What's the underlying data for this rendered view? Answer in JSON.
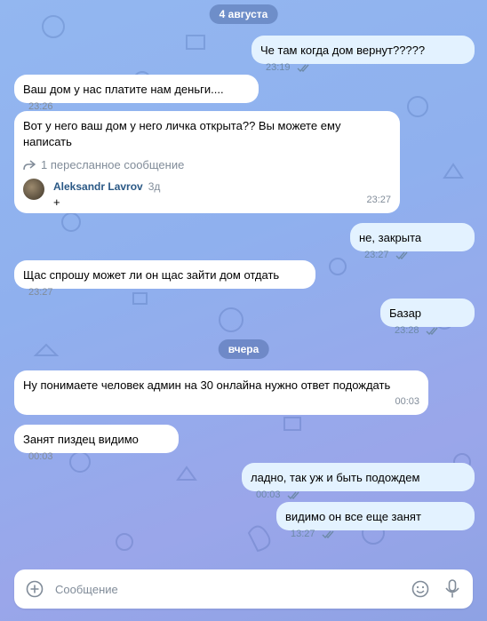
{
  "dates": [
    "4 августа",
    "вчера"
  ],
  "messages": [
    {
      "text": "Че там когда дом вернут?????",
      "time": "23:19",
      "dir": "out"
    },
    {
      "text": "Ваш дом у нас платите нам деньги....",
      "time": "23:26",
      "dir": "in"
    },
    {
      "text": "Вот у него ваш дом у него личка открыта?? Вы можете ему написать",
      "time": "23:27",
      "dir": "in",
      "forwarded": {
        "header": "1 пересланное сообщение",
        "author": "Aleksandr Lavrov",
        "ago": "3д",
        "text": "+"
      }
    },
    {
      "text": "не, закрыта",
      "time": "23:27",
      "dir": "out"
    },
    {
      "text": "Щас спрошу может ли он щас зайти дом отдать",
      "time": "23:27",
      "dir": "in"
    },
    {
      "text": "Базар",
      "time": "23:28",
      "dir": "out"
    },
    {
      "text": "Ну понимаете человек админ на 30 онлайна нужно ответ подождать",
      "time": "00:03",
      "dir": "in"
    },
    {
      "text": "Занят пиздец видимо",
      "time": "00:03",
      "dir": "in"
    },
    {
      "text": "ладно, так уж и быть подождем",
      "time": "00:03",
      "dir": "out"
    },
    {
      "text": "видимо он все еще занят",
      "time": "13:27",
      "dir": "out"
    }
  ],
  "composer": {
    "placeholder": "Сообщение"
  },
  "icons": {
    "attach": "plus-circle-icon",
    "emoji": "smile-icon",
    "voice": "microphone-icon",
    "read": "double-check-icon",
    "forward": "forward-arrow-icon"
  },
  "colors": {
    "outgoing_bubble": "#e3f2ff",
    "incoming_bubble": "#ffffff",
    "accent": "#2a5885"
  }
}
